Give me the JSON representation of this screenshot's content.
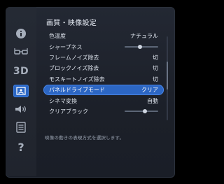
{
  "menu": {
    "title": "画質・映像設定",
    "hint": "映像の動きの表現方式を選択します。",
    "items": [
      {
        "label": "色温度",
        "value": "ナチュラル"
      },
      {
        "label": "シャープネス",
        "value": "",
        "slider": 0.4
      },
      {
        "label": "フレームノイズ除去",
        "value": "切"
      },
      {
        "label": "ブロックノイズ除去",
        "value": "切"
      },
      {
        "label": "モスキートノイズ除去",
        "value": "切"
      },
      {
        "label": "パネルドライブモード",
        "value": "クリア",
        "selected": true
      },
      {
        "label": "シネマ変換",
        "value": "自動"
      },
      {
        "label": "クリアブラック",
        "value": "",
        "slider": 0.55
      }
    ]
  },
  "sidebar": {
    "items": [
      {
        "icon": "info-icon"
      },
      {
        "icon": "glasses-icon"
      },
      {
        "icon": "3d-icon",
        "text": "3D"
      },
      {
        "icon": "picture-icon",
        "active": true
      },
      {
        "icon": "speaker-icon"
      },
      {
        "icon": "list-icon"
      },
      {
        "icon": "help-icon",
        "text": "?"
      }
    ]
  },
  "colors": {
    "accent": "#2c66c3",
    "panel": "#1e222b",
    "text": "#dfe5ee"
  }
}
